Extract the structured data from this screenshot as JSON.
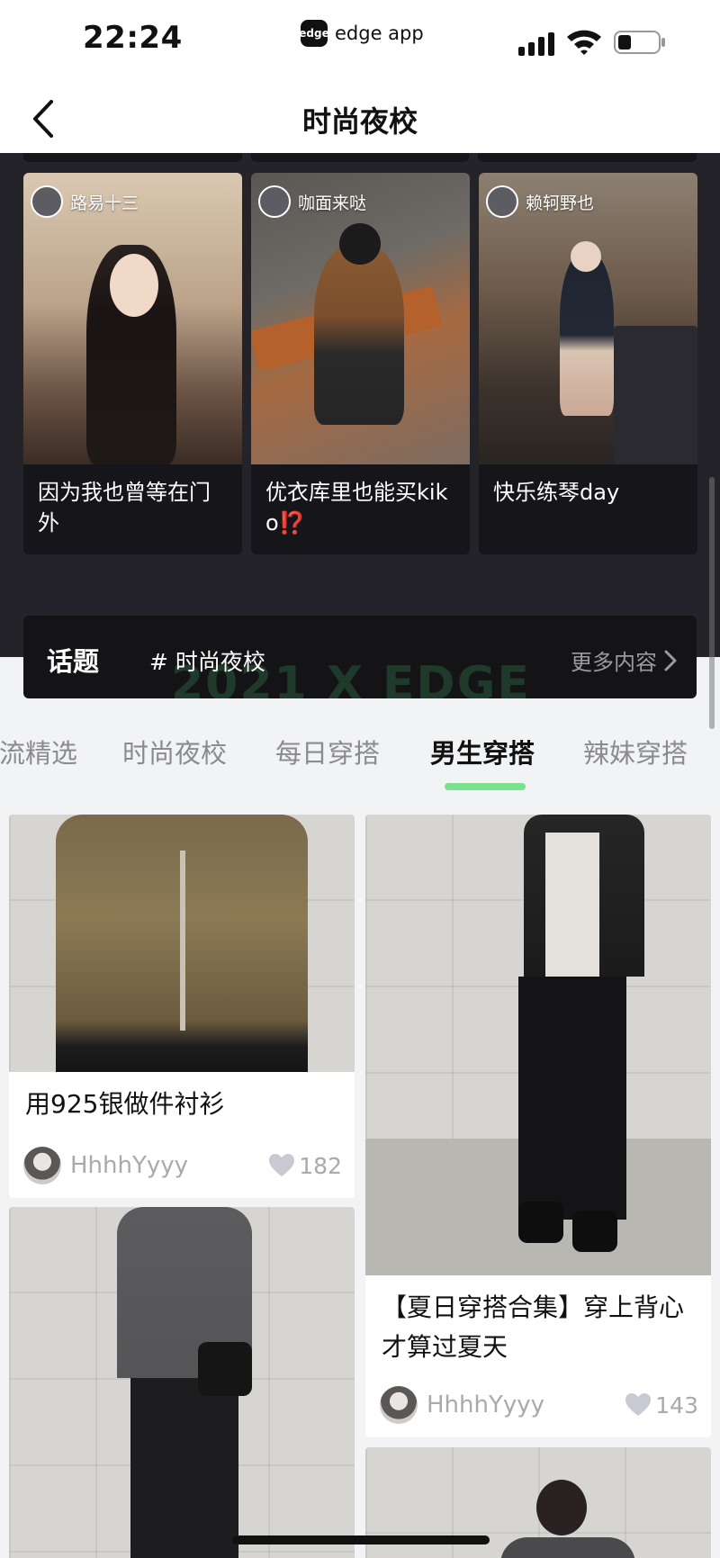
{
  "status_bar": {
    "time": "22:24",
    "app_logo": "edge",
    "app_name": "edge app",
    "icons": [
      "signal-icon",
      "wifi-icon",
      "battery-icon"
    ]
  },
  "nav": {
    "back_icon": "chevron-left-icon",
    "title": "时尚夜校"
  },
  "video_cards": [
    {
      "author": "路易十三",
      "title": "因为我也曾等在门外"
    },
    {
      "author": "咖面来哒",
      "title": "优衣库里也能买kiko⁉️"
    },
    {
      "author": "赖轲野也",
      "title": "快乐练琴day"
    }
  ],
  "topic": {
    "label": "话题",
    "tag": "# 时尚夜校",
    "watermark": "2021 X EDGE",
    "more": "更多内容"
  },
  "tabs": [
    {
      "label": "潮流精选",
      "active": false
    },
    {
      "label": "时尚夜校",
      "active": false
    },
    {
      "label": "每日穿搭",
      "active": false
    },
    {
      "label": "男生穿搭",
      "active": true
    },
    {
      "label": "辣妹穿搭",
      "active": false
    }
  ],
  "feed": [
    {
      "title": "用925银做件衬衫",
      "user": "HhhhYyyy",
      "likes": "182"
    },
    {
      "title": "【夏日穿搭合集】穿上背心才算过夏天",
      "user": "HhhhYyyy",
      "likes": "143"
    },
    {
      "title": "",
      "user": "",
      "likes": ""
    },
    {
      "title": "",
      "user": "",
      "likes": ""
    }
  ],
  "colors": {
    "accent": "#7ae28e",
    "dark_section": "#232329",
    "card_dark": "#16161a"
  }
}
